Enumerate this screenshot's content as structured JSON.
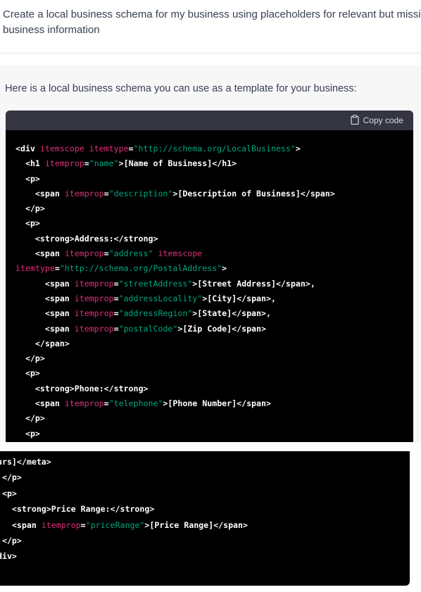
{
  "user_message": {
    "line1": "Create a local business schema for my business using placeholders for relevant but missing",
    "line2": "business information"
  },
  "assistant": {
    "intro": "Here is a local business schema you can use as a template for your business:",
    "copy_label": "Copy code"
  },
  "code_top": [
    [
      [
        "tag",
        "<div "
      ],
      [
        "attr",
        "itemscope itemtype"
      ],
      [
        "tag",
        "="
      ],
      [
        "str",
        "\"http://schema.org/LocalBusiness\""
      ],
      [
        "tag",
        ">"
      ]
    ],
    [
      [
        "tag",
        "  <h1 "
      ],
      [
        "attr",
        "itemprop"
      ],
      [
        "tag",
        "="
      ],
      [
        "str",
        "\"name\""
      ],
      [
        "tag",
        ">[Name of Business]</h1>"
      ]
    ],
    [
      [
        "tag",
        "  <p>"
      ]
    ],
    [
      [
        "tag",
        "    <span "
      ],
      [
        "attr",
        "itemprop"
      ],
      [
        "tag",
        "="
      ],
      [
        "str",
        "\"description\""
      ],
      [
        "tag",
        ">[Description of Business]</span>"
      ]
    ],
    [
      [
        "tag",
        "  </p>"
      ]
    ],
    [
      [
        "tag",
        "  <p>"
      ]
    ],
    [
      [
        "tag",
        "    <strong>Address:</strong>"
      ]
    ],
    [
      [
        "tag",
        "    <span "
      ],
      [
        "attr",
        "itemprop"
      ],
      [
        "tag",
        "="
      ],
      [
        "str",
        "\"address\""
      ],
      [
        "tag",
        " "
      ],
      [
        "attr",
        "itemscope"
      ]
    ],
    [
      [
        "attr",
        "itemtype"
      ],
      [
        "tag",
        "="
      ],
      [
        "str",
        "\"http://schema.org/PostalAddress\""
      ],
      [
        "tag",
        ">"
      ]
    ],
    [
      [
        "tag",
        "      <span "
      ],
      [
        "attr",
        "itemprop"
      ],
      [
        "tag",
        "="
      ],
      [
        "str",
        "\"streetAddress\""
      ],
      [
        "tag",
        ">[Street Address]</span>,"
      ]
    ],
    [
      [
        "tag",
        "      <span "
      ],
      [
        "attr",
        "itemprop"
      ],
      [
        "tag",
        "="
      ],
      [
        "str",
        "\"addressLocality\""
      ],
      [
        "tag",
        ">[City]</span>,"
      ]
    ],
    [
      [
        "tag",
        "      <span "
      ],
      [
        "attr",
        "itemprop"
      ],
      [
        "tag",
        "="
      ],
      [
        "str",
        "\"addressRegion\""
      ],
      [
        "tag",
        ">[State]</span>,"
      ]
    ],
    [
      [
        "tag",
        "      <span "
      ],
      [
        "attr",
        "itemprop"
      ],
      [
        "tag",
        "="
      ],
      [
        "str",
        "\"postalCode\""
      ],
      [
        "tag",
        ">[Zip Code]</span>"
      ]
    ],
    [
      [
        "tag",
        "    </span>"
      ]
    ],
    [
      [
        "tag",
        "  </p>"
      ]
    ],
    [
      [
        "tag",
        "  <p>"
      ]
    ],
    [
      [
        "tag",
        "    <strong>Phone:</strong>"
      ]
    ],
    [
      [
        "tag",
        "    <span "
      ],
      [
        "attr",
        "itemprop"
      ],
      [
        "tag",
        "="
      ],
      [
        "str",
        "\"telephone\""
      ],
      [
        "tag",
        ">[Phone Number]</span>"
      ]
    ],
    [
      [
        "tag",
        "  </p>"
      ]
    ],
    [
      [
        "tag",
        "  <p>"
      ]
    ]
  ],
  "code_bottom": [
    [
      [
        "tag",
        "ours]</meta>"
      ]
    ],
    [
      [
        "tag",
        "  </p>"
      ]
    ],
    [
      [
        "tag",
        "  <p>"
      ]
    ],
    [
      [
        "tag",
        "    <strong>Price Range:</strong>"
      ]
    ],
    [
      [
        "tag",
        "    <span "
      ],
      [
        "attr",
        "itemprop"
      ],
      [
        "tag",
        "="
      ],
      [
        "str",
        "\"priceRange\""
      ],
      [
        "tag",
        ">[Price Range]</span>"
      ]
    ],
    [
      [
        "tag",
        "  </p>"
      ]
    ],
    [
      [
        "tag",
        "/div>"
      ]
    ]
  ]
}
